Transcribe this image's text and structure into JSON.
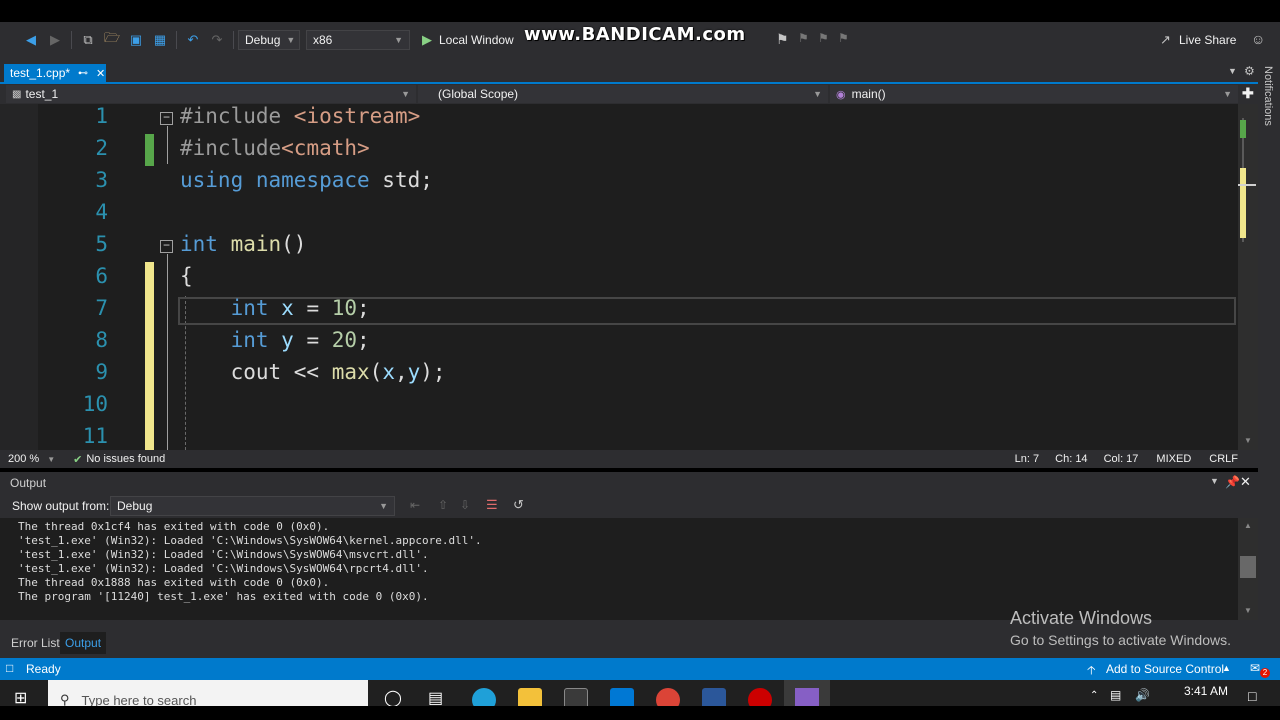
{
  "toolbar": {
    "config": "Debug",
    "platform": "x86",
    "run_label": "Local Window",
    "watermark": "www.BANDICAM.com",
    "live_share": "Live Share"
  },
  "tab": {
    "file": "test_1.cpp*"
  },
  "navbar": {
    "project": "test_1",
    "scope": "(Global Scope)",
    "member": "main()"
  },
  "editor": {
    "line_numbers": [
      "1",
      "2",
      "3",
      "4",
      "5",
      "6",
      "7",
      "8",
      "9",
      "10",
      "11"
    ],
    "lines": [
      {
        "parts": [
          {
            "t": "#include ",
            "c": "inc"
          },
          {
            "t": "<iostream>",
            "c": "str"
          }
        ]
      },
      {
        "parts": [
          {
            "t": "#include",
            "c": "inc"
          },
          {
            "t": "<cmath>",
            "c": "str"
          }
        ]
      },
      {
        "parts": [
          {
            "t": "using ",
            "c": "kw"
          },
          {
            "t": "namespace ",
            "c": "kw"
          },
          {
            "t": "std;",
            "c": ""
          }
        ]
      },
      {
        "parts": []
      },
      {
        "parts": [
          {
            "t": "int ",
            "c": "kw"
          },
          {
            "t": "main",
            "c": "fn"
          },
          {
            "t": "()",
            "c": ""
          }
        ]
      },
      {
        "parts": [
          {
            "t": "{",
            "c": ""
          }
        ]
      },
      {
        "parts": [
          {
            "t": "    int ",
            "c": "kw"
          },
          {
            "t": "x",
            "c": "var"
          },
          {
            "t": " = ",
            "c": ""
          },
          {
            "t": "10",
            "c": "num"
          },
          {
            "t": ";",
            "c": ""
          }
        ]
      },
      {
        "parts": [
          {
            "t": "    int ",
            "c": "kw"
          },
          {
            "t": "y",
            "c": "var"
          },
          {
            "t": " = ",
            "c": ""
          },
          {
            "t": "20",
            "c": "num"
          },
          {
            "t": ";",
            "c": ""
          }
        ]
      },
      {
        "parts": [
          {
            "t": "    cout << ",
            "c": ""
          },
          {
            "t": "max",
            "c": "fn"
          },
          {
            "t": "(",
            "c": ""
          },
          {
            "t": "x",
            "c": "var"
          },
          {
            "t": ",",
            "c": ""
          },
          {
            "t": "y",
            "c": "var"
          },
          {
            "t": ");",
            "c": ""
          }
        ]
      },
      {
        "parts": []
      },
      {
        "parts": []
      }
    ]
  },
  "editor_status": {
    "zoom": "200 %",
    "issues": "No issues found",
    "ln": "Ln: 7",
    "ch": "Ch: 14",
    "col": "Col: 17",
    "mixed": "MIXED",
    "crlf": "CRLF"
  },
  "output": {
    "title": "Output",
    "show_from_label": "Show output from:",
    "source": "Debug",
    "lines": [
      "The thread 0x1cf4 has exited with code 0 (0x0).",
      "'test_1.exe' (Win32): Loaded 'C:\\Windows\\SysWOW64\\kernel.appcore.dll'.",
      "'test_1.exe' (Win32): Loaded 'C:\\Windows\\SysWOW64\\msvcrt.dll'.",
      "'test_1.exe' (Win32): Loaded 'C:\\Windows\\SysWOW64\\rpcrt4.dll'.",
      "The thread 0x1888 has exited with code 0 (0x0).",
      "The program '[11240] test_1.exe' has exited with code 0 (0x0)."
    ]
  },
  "bottom_tabs": {
    "error_list": "Error List",
    "output": "Output"
  },
  "status": {
    "ready": "Ready",
    "source_control": "Add to Source Control",
    "badge": "2"
  },
  "notifications": "Notifications",
  "activation": {
    "title": "Activate Windows",
    "subtitle": "Go to Settings to activate Windows."
  },
  "taskbar": {
    "search_placeholder": "Type here to search",
    "time": "3:41 AM"
  },
  "colors": {
    "accent": "#007acc",
    "editor_bg": "#1e1e1e",
    "chrome": "#2d2d30",
    "changed_margin": "#f0e68c",
    "saved_margin": "#57a64a"
  }
}
